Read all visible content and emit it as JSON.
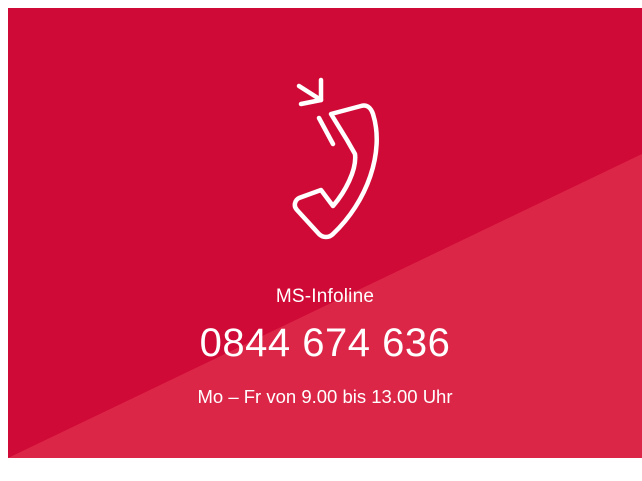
{
  "infoline": {
    "title": "MS-Infoline",
    "phone": "0844 674 636",
    "hours": "Mo – Fr von 9.00 bis 13.00 Uhr",
    "icon": "incoming-phone-call-icon"
  },
  "colors": {
    "background": "#d00a36",
    "accent_light": "#e0304f",
    "text": "#ffffff"
  }
}
